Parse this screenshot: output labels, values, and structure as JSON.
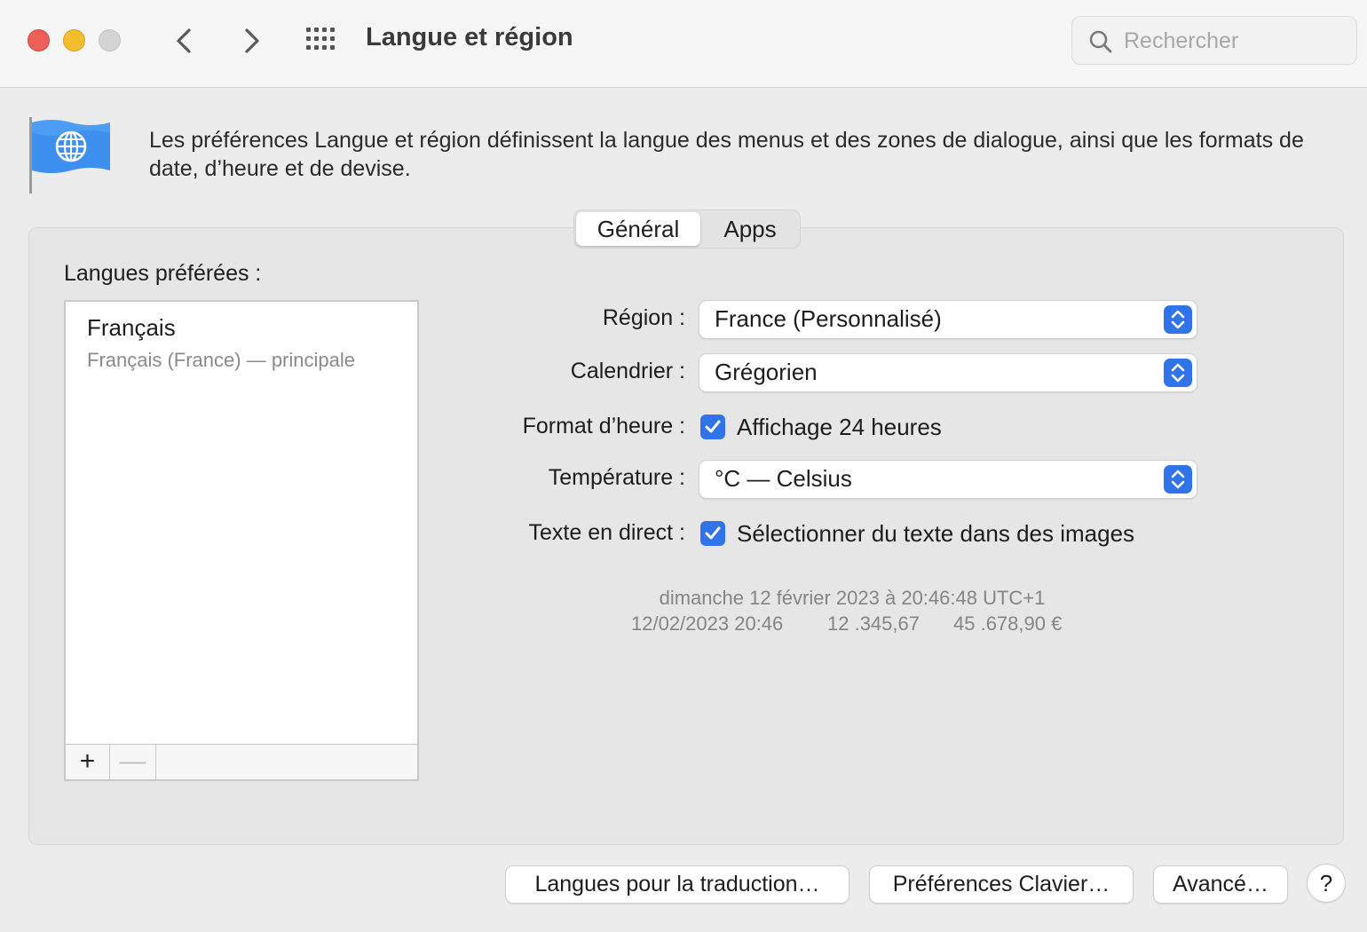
{
  "window": {
    "title": "Langue et région"
  },
  "search": {
    "placeholder": "Rechercher"
  },
  "icons": {
    "close": "close-traffic-light",
    "minimize": "minimize-traffic-light",
    "zoom": "zoom-traffic-light",
    "back": "chevron-left-icon",
    "forward": "chevron-right-icon",
    "grid": "grid-icon",
    "search": "search-icon",
    "pane": "flag-globe-icon",
    "checkbox": "checkmark-icon",
    "popup": "up-down-arrows-icon"
  },
  "colors": {
    "accent": "#2f74e8",
    "close": "#ed5f57",
    "minimize": "#f4bd30",
    "zoom": "#d4d4d4"
  },
  "header": {
    "description": "Les préférences Langue et région définissent la langue des menus et des zones de dialogue, ainsi que les formats de date, d’heure et de devise."
  },
  "tabs": [
    {
      "label": "Général",
      "selected": true
    },
    {
      "label": "Apps",
      "selected": false
    }
  ],
  "languages": {
    "label": "Langues préférées :",
    "items": [
      {
        "name": "Français",
        "detail": "Français (France) — principale"
      }
    ],
    "add_label": "+",
    "remove_label": "—"
  },
  "form": {
    "region": {
      "label": "Région :",
      "value": "France (Personnalisé)"
    },
    "calendar": {
      "label": "Calendrier :",
      "value": "Grégorien"
    },
    "time_format": {
      "label": "Format d’heure :",
      "checkbox_label": "Affichage 24 heures",
      "checked": true
    },
    "temperature": {
      "label": "Température :",
      "value": "°C — Celsius"
    },
    "live_text": {
      "label": "Texte en direct :",
      "checkbox_label": "Sélectionner du texte dans des images",
      "checked": true
    }
  },
  "sample": {
    "long_date": "dimanche 12 février 2023 à 20:46:48 UTC+1",
    "short_date": "12/02/2023 20:46",
    "number": "12 .345,67",
    "currency": "45 .678,90 €"
  },
  "buttons": {
    "translation": "Langues pour la traduction…",
    "keyboard": "Préférences Clavier…",
    "advanced": "Avancé…",
    "help": "?"
  }
}
